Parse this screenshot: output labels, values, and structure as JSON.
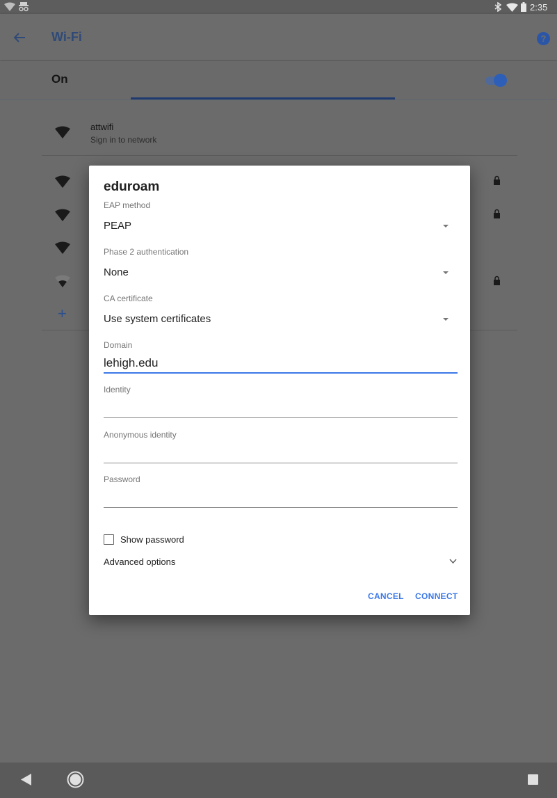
{
  "status_bar": {
    "time": "2:35"
  },
  "app_bar": {
    "title": "Wi-Fi"
  },
  "wifi_switch": {
    "label": "On",
    "enabled": true
  },
  "networks": [
    {
      "name": "attwifi",
      "status": "Sign in to network"
    }
  ],
  "dialog": {
    "title": "eduroam",
    "eap_method": {
      "label": "EAP method",
      "value": "PEAP"
    },
    "phase2": {
      "label": "Phase 2 authentication",
      "value": "None"
    },
    "ca_certificate": {
      "label": "CA certificate",
      "value": "Use system certificates"
    },
    "domain": {
      "label": "Domain",
      "value": "lehigh.edu"
    },
    "identity": {
      "label": "Identity",
      "value": ""
    },
    "anonymous_identity": {
      "label": "Anonymous identity",
      "value": ""
    },
    "password": {
      "label": "Password",
      "value": ""
    },
    "show_password": {
      "label": "Show password",
      "checked": false
    },
    "advanced_options": {
      "label": "Advanced options"
    },
    "cancel_label": "CANCEL",
    "connect_label": "CONNECT"
  },
  "colors": {
    "accent": "#3b78e7",
    "help": "#2b56a8",
    "switch": "#2e5fb8"
  }
}
